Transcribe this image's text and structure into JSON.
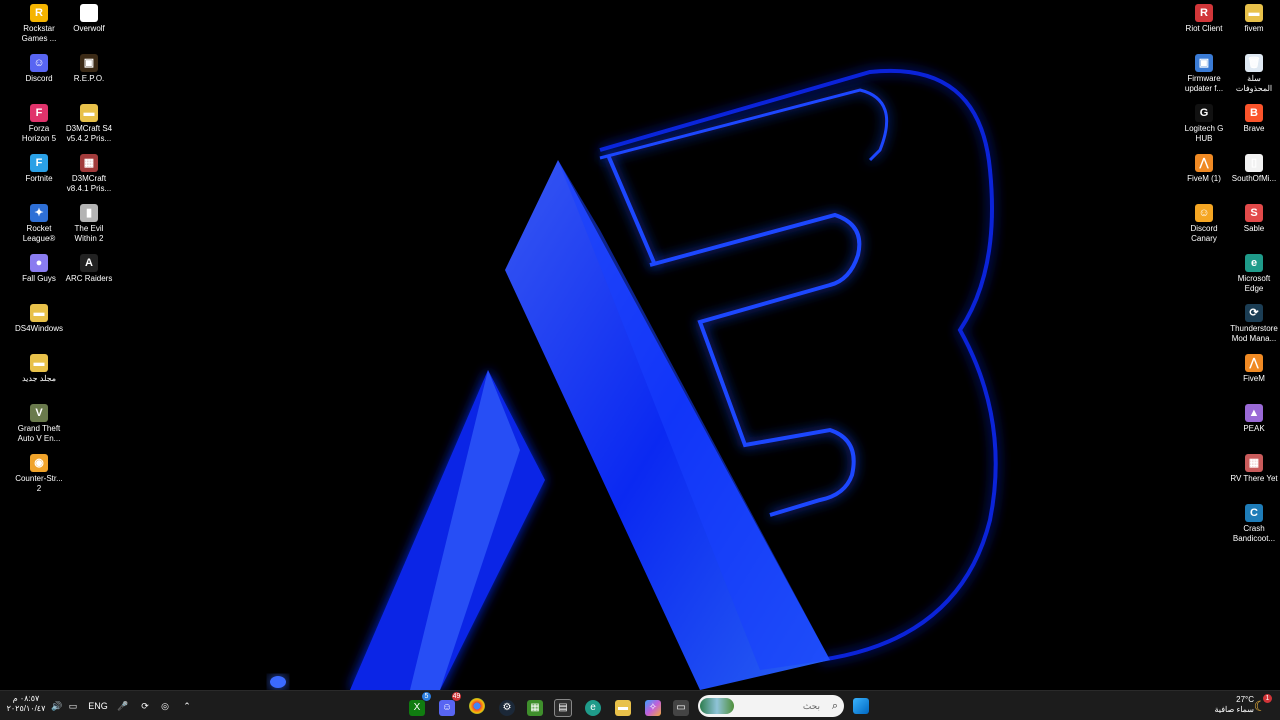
{
  "desktop": {
    "left_icons": [
      {
        "label": "Rockstar\nGames ...",
        "glyph": "R",
        "color": "#f5b400",
        "icon": "rockstar-icon"
      },
      {
        "label": "Overwolf",
        "glyph": "◆",
        "color": "#ffffff",
        "icon": "overwolf-icon"
      },
      {
        "label": "Discord",
        "glyph": "☺",
        "color": "#5865f2",
        "icon": "discord-icon"
      },
      {
        "label": "R.E.P.O.",
        "glyph": "▣",
        "color": "#3b2a16",
        "icon": "repo-icon"
      },
      {
        "label": "Forza\nHorizon 5",
        "glyph": "F",
        "color": "#e0336b",
        "icon": "forza-icon"
      },
      {
        "label": "D3MCraft S4\nv5.4.2 Pris...",
        "glyph": "▬",
        "color": "#e8c14a",
        "icon": "folder-icon"
      },
      {
        "label": "Fortnite",
        "glyph": "F",
        "color": "#2aa0e6",
        "icon": "fortnite-icon"
      },
      {
        "label": "D3MCraft\nv8.4.1 Pris...",
        "glyph": "▦",
        "color": "#a23b3b",
        "icon": "d3mcraft-icon"
      },
      {
        "label": "Rocket\nLeague®",
        "glyph": "✦",
        "color": "#2e6fd6",
        "icon": "rocket-league-icon"
      },
      {
        "label": "The Evil\nWithin 2",
        "glyph": "▮",
        "color": "#b3b3b3",
        "icon": "evil-within-icon"
      },
      {
        "label": "Fall Guys",
        "glyph": "●",
        "color": "#8a7cf0",
        "icon": "fall-guys-icon"
      },
      {
        "label": "ARC Raiders",
        "glyph": "A",
        "color": "#222222",
        "icon": "arc-raiders-icon"
      },
      {
        "label": "DS4Windows",
        "glyph": "▬",
        "color": "#e8c14a",
        "icon": "folder-icon"
      },
      {
        "label": "مجلد جديد",
        "glyph": "▬",
        "color": "#e8c14a",
        "icon": "folder-icon"
      },
      {
        "label": "Grand Theft\nAuto V En...",
        "glyph": "V",
        "color": "#6a7a4c",
        "icon": "gta-icon"
      },
      {
        "label": "Counter-Str...\n2",
        "glyph": "◉",
        "color": "#f0a32a",
        "icon": "counter-strike-icon"
      }
    ],
    "right_icons": [
      {
        "label": "Riot Client",
        "glyph": "R",
        "color": "#d13639",
        "icon": "riot-icon"
      },
      {
        "label": "fivem",
        "glyph": "▬",
        "color": "#e8c14a",
        "icon": "folder-icon"
      },
      {
        "label": "Firmware\nupdater f...",
        "glyph": "▣",
        "color": "#3a7bd5",
        "icon": "firmware-icon"
      },
      {
        "label": "سلة\nالمحذوفات",
        "glyph": "🗑",
        "color": "#dfe9f3",
        "icon": "recycle-bin-icon"
      },
      {
        "label": "Logitech G\nHUB",
        "glyph": "G",
        "color": "#111111",
        "icon": "logitech-icon"
      },
      {
        "label": "Brave",
        "glyph": "B",
        "color": "#fb542b",
        "icon": "brave-icon"
      },
      {
        "label": "FiveM (1)",
        "glyph": "⋀",
        "color": "#f08a24",
        "icon": "fivem-icon"
      },
      {
        "label": "SouthOfMi...",
        "glyph": "▯",
        "color": "#f2f2f2",
        "icon": "file-icon"
      },
      {
        "label": "Discord\nCanary",
        "glyph": "☺",
        "color": "#f5a623",
        "icon": "discord-canary-icon"
      },
      {
        "label": "Sable",
        "glyph": "S",
        "color": "#e24a4a",
        "icon": "sable-icon"
      },
      {
        "label": "Microsoft\nEdge",
        "glyph": "e",
        "color": "#1f9b8a",
        "icon": "edge-icon"
      },
      {
        "label": "Thunderstore\nMod Mana...",
        "glyph": "⟳",
        "color": "#1b3d54",
        "icon": "thunderstore-icon"
      },
      {
        "label": "FiveM",
        "glyph": "⋀",
        "color": "#f08a24",
        "icon": "fivem-icon"
      },
      {
        "label": "PEAK",
        "glyph": "▲",
        "color": "#9a6ad6",
        "icon": "peak-icon"
      },
      {
        "label": "RV There Yet",
        "glyph": "▦",
        "color": "#c95b5b",
        "icon": "rv-icon"
      },
      {
        "label": "Crash\nBandicoot...",
        "glyph": "C",
        "color": "#1e7cb8",
        "icon": "crash-icon"
      }
    ]
  },
  "taskbar": {
    "clock": {
      "time": "٠٨:٥٧ م",
      "date": "٢٠٢٥/١٠/٤٧"
    },
    "language": "ENG",
    "search_placeholder": "بحث",
    "weather": {
      "temp": "27°C",
      "desc": "سماء صافية",
      "badge": "1"
    },
    "badges": {
      "xbox": "5",
      "discord": "49"
    },
    "apps": [
      "xbox",
      "discord",
      "chrome",
      "steam",
      "minecraft",
      "store",
      "edge",
      "files",
      "copilot",
      "taskview"
    ]
  },
  "colors": {
    "accent": "#1a3cff",
    "taskbar": "#1c1c1c"
  }
}
